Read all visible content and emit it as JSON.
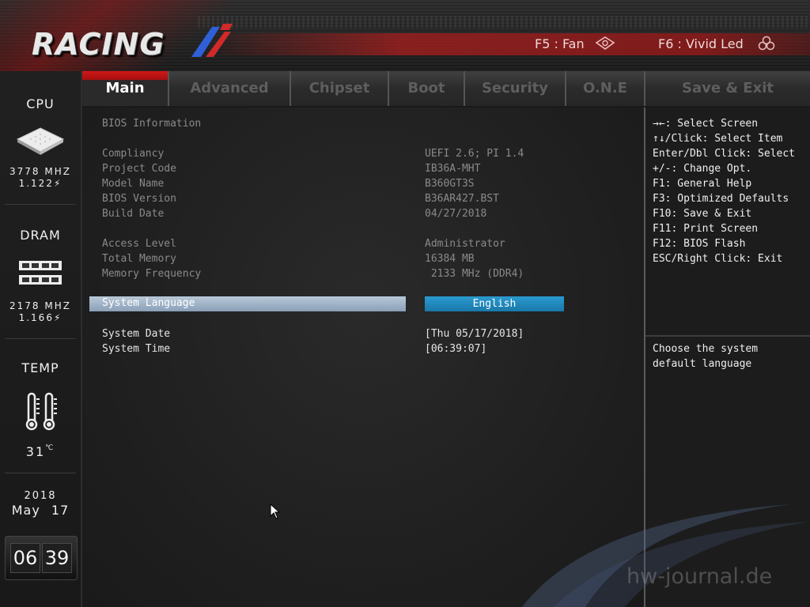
{
  "header": {
    "logo_text": "RACING",
    "f5_label": "F5 : Fan",
    "f6_label": "F6 : Vivid Led"
  },
  "tabs": [
    {
      "label": "Main",
      "active": true
    },
    {
      "label": "Advanced",
      "active": false
    },
    {
      "label": "Chipset",
      "active": false
    },
    {
      "label": "Boot",
      "active": false
    },
    {
      "label": "Security",
      "active": false
    },
    {
      "label": "O.N.E",
      "active": false
    },
    {
      "label": "Save & Exit",
      "active": false
    }
  ],
  "sidebar": {
    "cpu": {
      "title": "CPU",
      "freq": "3778 MHZ",
      "volt": "1.122"
    },
    "dram": {
      "title": "DRAM",
      "freq": "2178 MHZ",
      "volt": "1.166"
    },
    "temp": {
      "title": "TEMP",
      "value": "31"
    },
    "date": {
      "year": "2018",
      "month_day": "May 17"
    },
    "clock": {
      "hours": "06",
      "minutes": "39"
    }
  },
  "main": {
    "section_title": "BIOS Information",
    "info": [
      {
        "label": "Compliancy",
        "value": "UEFI 2.6; PI 1.4"
      },
      {
        "label": "Project Code",
        "value": "IB36A-MHT"
      },
      {
        "label": "Model Name",
        "value": "B360GT3S"
      },
      {
        "label": "BIOS Version",
        "value": "B36AR427.BST"
      },
      {
        "label": "Build Date",
        "value": "04/27/2018"
      }
    ],
    "access": [
      {
        "label": "Access Level",
        "value": "Administrator"
      },
      {
        "label": "Total Memory",
        "value": "16384 MB"
      },
      {
        "label": "Memory Frequency",
        "value": " 2133 MHz (DDR4)"
      }
    ],
    "language": {
      "label": "System Language",
      "value": "English"
    },
    "date": {
      "label": "System Date",
      "value": "[Thu 05/17/2018]"
    },
    "time": {
      "label": "System Time",
      "value": "[06:39:07]"
    }
  },
  "help": {
    "keys": [
      "→←: Select Screen",
      "↑↓/Click: Select Item",
      "Enter/Dbl Click: Select",
      "+/-: Change Opt.",
      "F1: General Help",
      "F3: Optimized Defaults",
      "F10: Save & Exit",
      "F11: Print Screen",
      "F12: BIOS Flash",
      "ESC/Right Click: Exit"
    ],
    "description": [
      "Choose the system",
      "default language"
    ]
  },
  "watermark": "hw-journal.de",
  "colors": {
    "active_tab": "#c41414",
    "highlight_bar": "#a8bccf",
    "value_highlight": "#2190c4"
  }
}
